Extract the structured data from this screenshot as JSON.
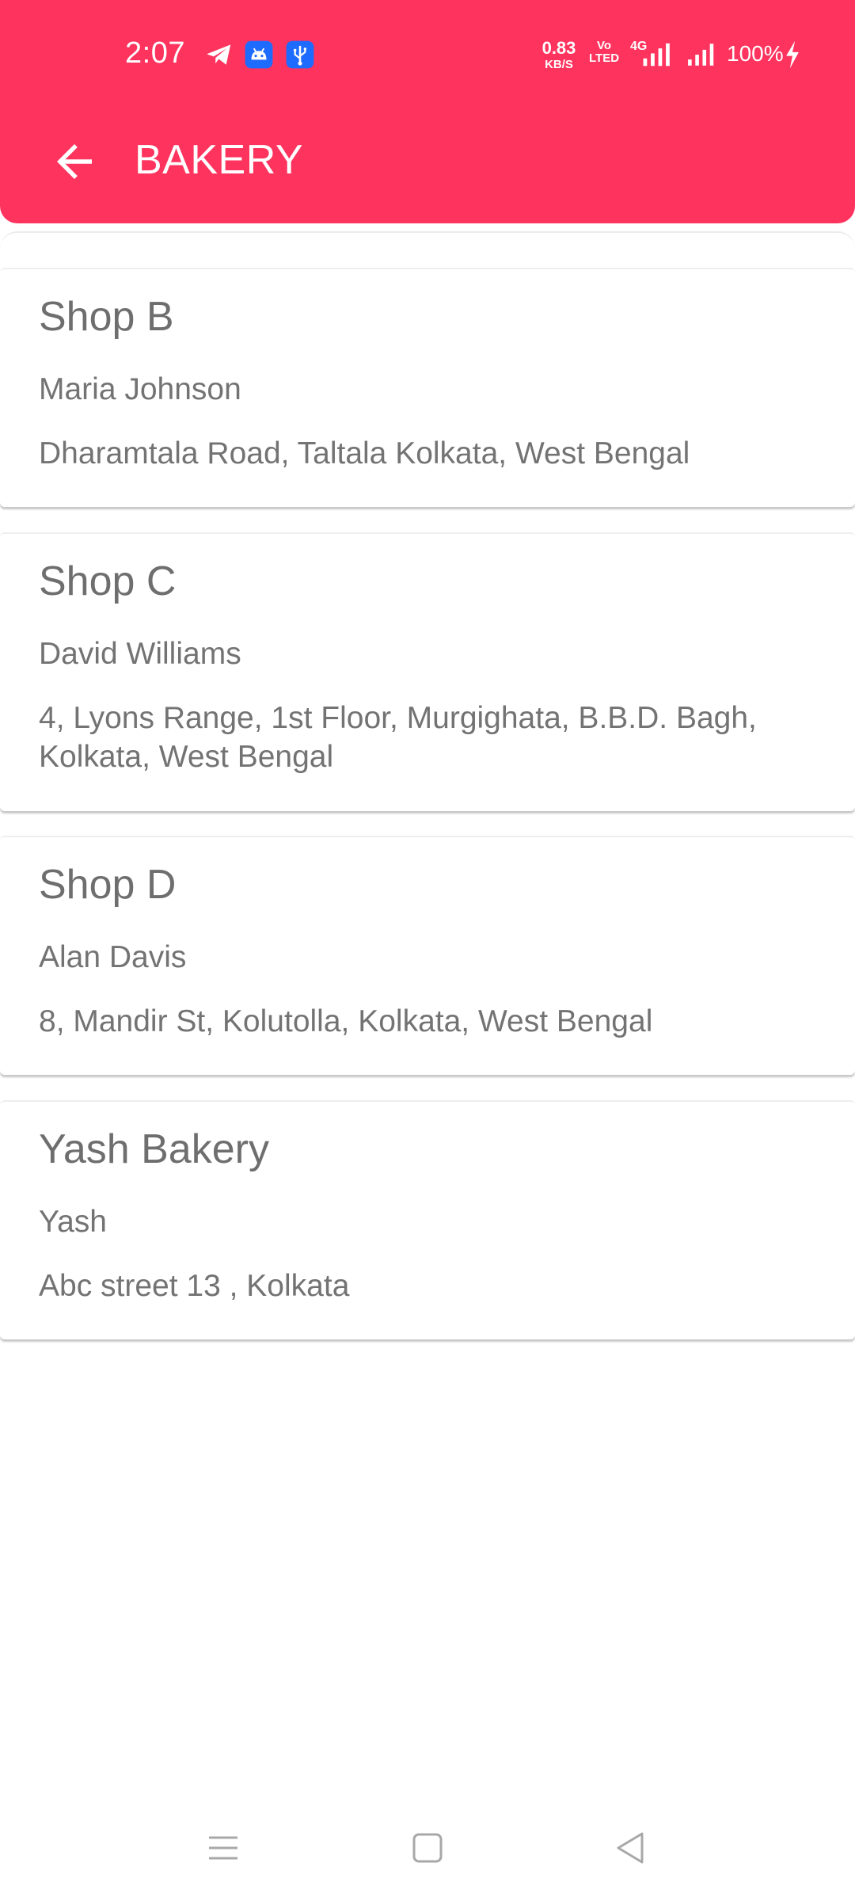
{
  "status_bar": {
    "time": "2:07",
    "net_speed_value": "0.83",
    "net_speed_unit": "KB/S",
    "volte_top": "Vo",
    "volte_bottom": "LTED",
    "network_type": "4G",
    "battery_percent": "100%",
    "icons": [
      "telegram-icon",
      "android-icon",
      "usb-icon",
      "signal-icon",
      "signal-icon",
      "charging-icon"
    ]
  },
  "toolbar": {
    "title": "BAKERY",
    "back_icon": "arrow-left-icon"
  },
  "shops": [
    {
      "name": "Shop B",
      "owner": "Maria Johnson",
      "address": "Dharamtala Road, Taltala Kolkata, West Bengal"
    },
    {
      "name": "Shop C",
      "owner": "David Williams",
      "address": "4, Lyons Range, 1st Floor, Murgighata, B.B.D. Bagh, Kolkata, West Bengal"
    },
    {
      "name": "Shop D",
      "owner": "Alan Davis",
      "address": "8, Mandir St, Kolutolla, Kolkata, West Bengal"
    },
    {
      "name": "Yash Bakery",
      "owner": "Yash",
      "address": "Abc street 13 , Kolkata"
    }
  ],
  "nav_bar": {
    "icons": [
      "menu-icon",
      "home-square-icon",
      "back-triangle-icon"
    ]
  },
  "colors": {
    "accent": "#fe335e",
    "card_text": "#737373",
    "background": "#ffffff"
  }
}
